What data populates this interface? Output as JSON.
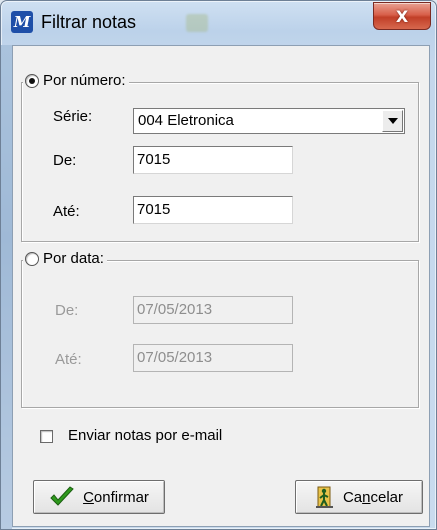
{
  "window": {
    "title": "Filtrar notas",
    "app_icon_glyph": "M",
    "close_glyph": "X"
  },
  "por_numero": {
    "label": "Por número:",
    "selected": true,
    "serie_label": "Série:",
    "serie_value": "004 Eletronica",
    "de_label": "De:",
    "de_value": "7015",
    "ate_label": "Até:",
    "ate_value": "7015"
  },
  "por_data": {
    "label": "Por data:",
    "selected": false,
    "de_label": "De:",
    "de_value": "07/05/2013",
    "ate_label": "Até:",
    "ate_value": "07/05/2013"
  },
  "email": {
    "label": "Enviar notas por e-mail",
    "checked": false
  },
  "buttons": {
    "confirmar_first": "C",
    "confirmar_rest": "onfirmar",
    "cancelar_pre": "Ca",
    "cancelar_u": "n",
    "cancelar_post": "celar"
  },
  "colors": {
    "check_green": "#2f9a1e",
    "cancel_icon": "#2a7a2a"
  }
}
